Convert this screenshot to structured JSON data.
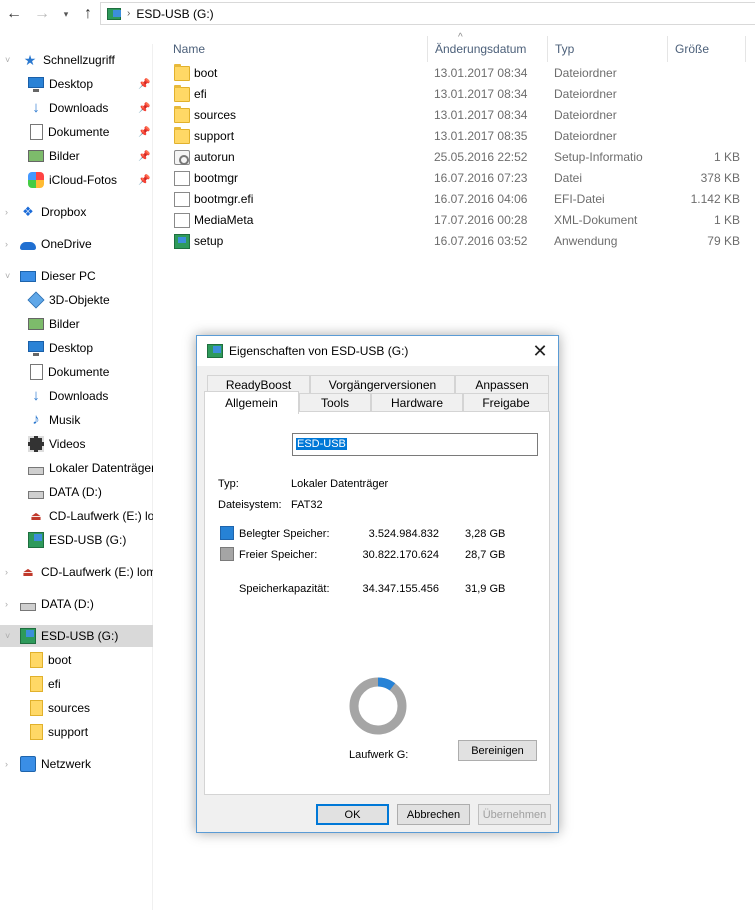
{
  "address": {
    "path": "ESD-USB (G:)"
  },
  "sidebar": {
    "quick_access": "Schnellzugriff",
    "quick_items": [
      "Desktop",
      "Downloads",
      "Dokumente",
      "Bilder",
      "iCloud-Fotos"
    ],
    "dropbox": "Dropbox",
    "onedrive": "OneDrive",
    "this_pc": "Dieser PC",
    "pc_items": [
      "3D-Objekte",
      "Bilder",
      "Desktop",
      "Dokumente",
      "Downloads",
      "Musik",
      "Videos",
      "Lokaler Datenträger",
      "DATA (D:)",
      "CD-Laufwerk (E:) lo",
      "ESD-USB (G:)"
    ],
    "cd_drive": "CD-Laufwerk (E:) lom",
    "data_drive": "DATA (D:)",
    "usb_drive": "ESD-USB (G:)",
    "usb_children": [
      "boot",
      "efi",
      "sources",
      "support"
    ],
    "network": "Netzwerk"
  },
  "columns": {
    "name": "Name",
    "date": "Änderungsdatum",
    "type": "Typ",
    "size": "Größe"
  },
  "files": [
    {
      "name": "boot",
      "date": "13.01.2017 08:34",
      "type": "Dateiordner",
      "size": "",
      "icon": "folder-icon"
    },
    {
      "name": "efi",
      "date": "13.01.2017 08:34",
      "type": "Dateiordner",
      "size": "",
      "icon": "folder-icon"
    },
    {
      "name": "sources",
      "date": "13.01.2017 08:34",
      "type": "Dateiordner",
      "size": "",
      "icon": "folder-icon"
    },
    {
      "name": "support",
      "date": "13.01.2017 08:35",
      "type": "Dateiordner",
      "size": "",
      "icon": "folder-icon"
    },
    {
      "name": "autorun",
      "date": "25.05.2016 22:52",
      "type": "Setup-Informatio",
      "size": "1 KB",
      "icon": "setup-info-icon"
    },
    {
      "name": "bootmgr",
      "date": "16.07.2016 07:23",
      "type": "Datei",
      "size": "378 KB",
      "icon": "file-icon"
    },
    {
      "name": "bootmgr.efi",
      "date": "16.07.2016 04:06",
      "type": "EFI-Datei",
      "size": "1.142 KB",
      "icon": "file-icon"
    },
    {
      "name": "MediaMeta",
      "date": "17.07.2016 00:28",
      "type": "XML-Dokument",
      "size": "1 KB",
      "icon": "file-icon"
    },
    {
      "name": "setup",
      "date": "16.07.2016 03:52",
      "type": "Anwendung",
      "size": "79 KB",
      "icon": "setup-app-icon"
    }
  ],
  "dialog": {
    "title": "Eigenschaften von ESD-USB (G:)",
    "tabs_row1": [
      "ReadyBoost",
      "Vorgängerversionen",
      "Anpassen"
    ],
    "tabs_row2": [
      "Allgemein",
      "Tools",
      "Hardware",
      "Freigabe"
    ],
    "volume_name": "ESD-USB",
    "type_label": "Typ:",
    "type_value": "Lokaler Datenträger",
    "fs_label": "Dateisystem:",
    "fs_value": "FAT32",
    "used_label": "Belegter Speicher:",
    "used_bytes": "3.524.984.832",
    "used_gb": "3,28 GB",
    "free_label": "Freier Speicher:",
    "free_bytes": "30.822.170.624",
    "free_gb": "28,7 GB",
    "capacity_label": "Speicherkapazität:",
    "capacity_bytes": "34.347.155.456",
    "capacity_gb": "31,9 GB",
    "drive_label": "Laufwerk G:",
    "cleanup_button": "Bereinigen",
    "ok_button": "OK",
    "cancel_button": "Abbrechen",
    "apply_button": "Übernehmen",
    "used_fraction": 0.1026,
    "colors": {
      "used": "#2682d6",
      "free": "#a5a5a5"
    }
  }
}
